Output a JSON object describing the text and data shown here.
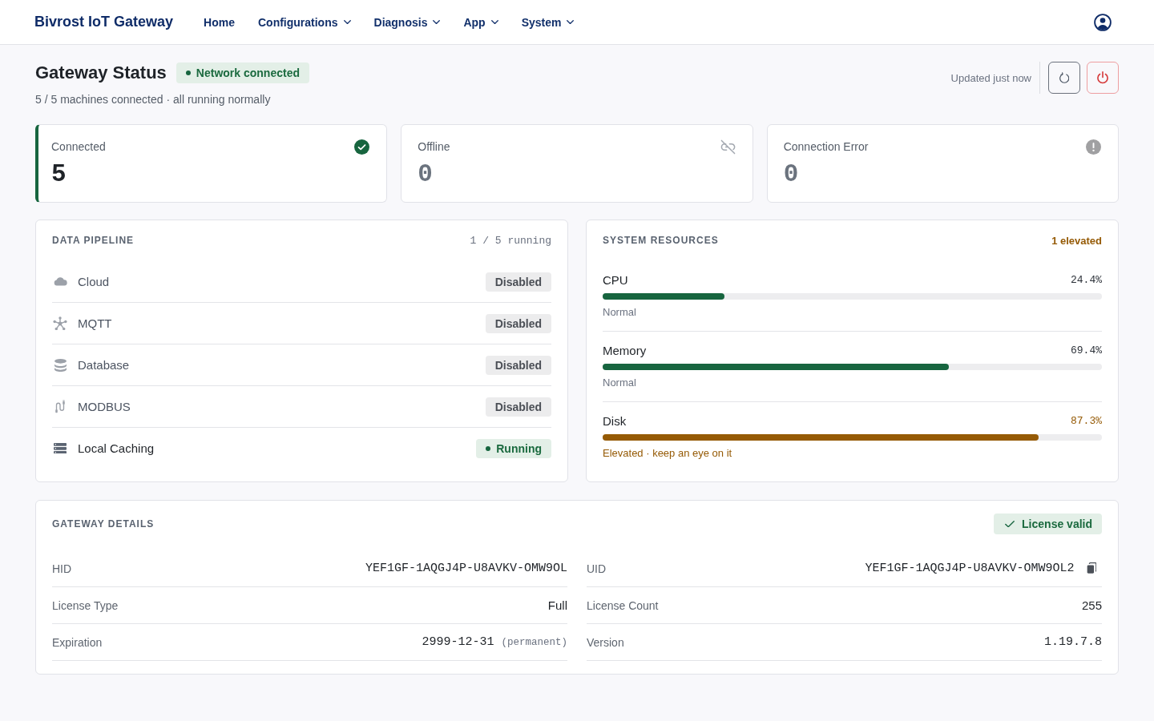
{
  "app": {
    "title": "Bivrost IoT Gateway"
  },
  "nav": [
    {
      "label": "Home",
      "dropdown": false
    },
    {
      "label": "Configurations",
      "dropdown": true
    },
    {
      "label": "Diagnosis",
      "dropdown": true
    },
    {
      "label": "App",
      "dropdown": true
    },
    {
      "label": "System",
      "dropdown": true
    }
  ],
  "status_header": {
    "title": "Gateway Status",
    "badge": "Network connected",
    "subtitle": "5 / 5 machines connected · all running normally",
    "updated": "Updated just now"
  },
  "stat_cards": [
    {
      "kind": "connected",
      "label": "Connected",
      "value": "5"
    },
    {
      "kind": "offline",
      "label": "Offline",
      "value": "0"
    },
    {
      "kind": "error",
      "label": "Connection Error",
      "value": "0"
    }
  ],
  "data_pipeline": {
    "title": "DATA PIPELINE",
    "summary": "1 / 5 running",
    "items": [
      {
        "kind": "cloud",
        "name": "Cloud",
        "status": "Disabled",
        "running": false
      },
      {
        "kind": "mqtt",
        "name": "MQTT",
        "status": "Disabled",
        "running": false
      },
      {
        "kind": "database",
        "name": "Database",
        "status": "Disabled",
        "running": false
      },
      {
        "kind": "modbus",
        "name": "MODBUS",
        "status": "Disabled",
        "running": false
      },
      {
        "kind": "cache",
        "name": "Local Caching",
        "status": "Running",
        "running": true
      }
    ]
  },
  "system_resources": {
    "title": "SYSTEM RESOURCES",
    "summary": "1 elevated",
    "items": [
      {
        "name": "CPU",
        "reading": "24.4%",
        "level": 0.244,
        "note": "Normal",
        "elevated": false
      },
      {
        "name": "Memory",
        "reading": "69.4%",
        "level": 0.694,
        "note": "Normal",
        "elevated": false
      },
      {
        "name": "Disk",
        "reading": "87.3%",
        "level": 0.873,
        "note": "Elevated · keep an eye on it",
        "elevated": true
      }
    ]
  },
  "gateway_details": {
    "title": "GATEWAY DETAILS",
    "badge": "License valid",
    "fields": [
      {
        "kind": "mono",
        "label": "HID",
        "value": "YEF1GF-1AQGJ4P-U8AVKV-OMW9OL",
        "copyable": false
      },
      {
        "kind": "mono",
        "label": "UID",
        "value": "YEF1GF-1AQGJ4P-U8AVKV-OMW9OL2",
        "copyable": true
      },
      {
        "kind": "text",
        "label": "License Type",
        "value": "Full",
        "copyable": false
      },
      {
        "kind": "text",
        "label": "License Count",
        "value": "255",
        "copyable": false
      },
      {
        "kind": "mono",
        "label": "Expiration",
        "value": "2999-12-31",
        "note": "(permanent)",
        "copyable": false
      },
      {
        "kind": "mono",
        "label": "Version",
        "value": "1.19.7.8",
        "copyable": false
      }
    ]
  }
}
